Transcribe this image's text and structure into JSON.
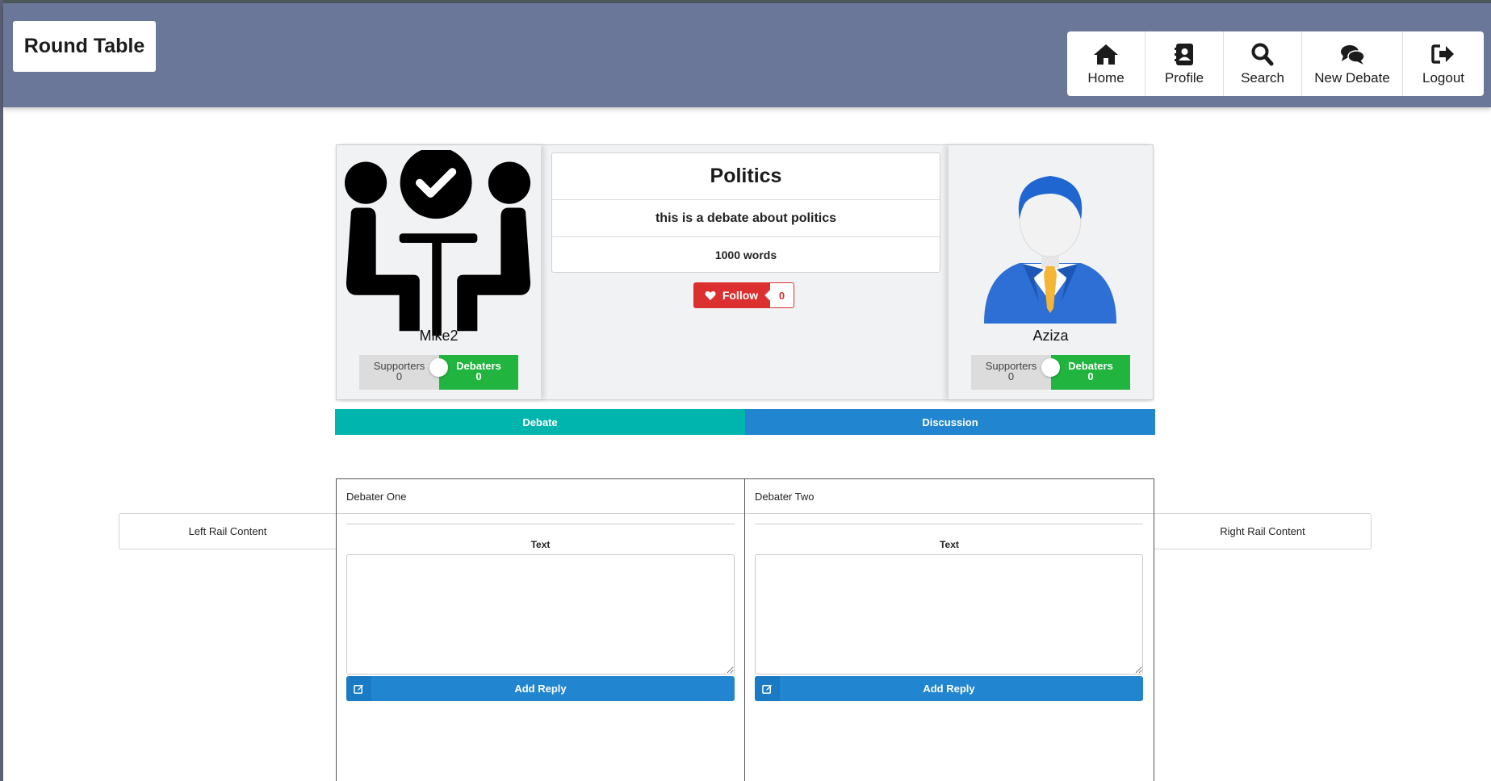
{
  "header": {
    "brand": "Round Table",
    "nav": [
      {
        "label": "Home",
        "icon": "home-icon"
      },
      {
        "label": "Profile",
        "icon": "profile-icon"
      },
      {
        "label": "Search",
        "icon": "search-icon"
      },
      {
        "label": "New Debate",
        "icon": "comments-icon"
      },
      {
        "label": "Logout",
        "icon": "logout-icon"
      }
    ]
  },
  "debate": {
    "title": "Politics",
    "description": "this is a debate about politics",
    "word_limit": "1000 words",
    "follow_label": "Follow",
    "follow_count": "0"
  },
  "debater_left": {
    "name": "Mike2",
    "supporters_label": "Supporters",
    "supporters_count": "0",
    "debaters_label": "Debaters",
    "debaters_count": "0"
  },
  "debater_right": {
    "name": "Aziza",
    "supporters_label": "Supporters",
    "supporters_count": "0",
    "debaters_label": "Debaters",
    "debaters_count": "0"
  },
  "tabs": {
    "debate": "Debate",
    "discussion": "Discussion"
  },
  "rails": {
    "left": "Left Rail Content",
    "right": "Right Rail Content"
  },
  "columns": [
    {
      "header": "Debater One",
      "text_label": "Text",
      "button": "Add Reply"
    },
    {
      "header": "Debater Two",
      "text_label": "Text",
      "button": "Add Reply"
    }
  ],
  "colors": {
    "header_bg": "#6b7798",
    "debate_tab": "#00b5ad",
    "discussion_tab": "#2185d0",
    "follow_red": "#dc2f2f",
    "debaters_green": "#21b43f"
  }
}
